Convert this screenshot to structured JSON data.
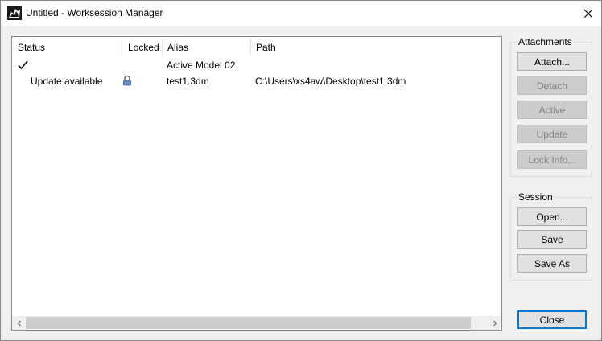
{
  "window": {
    "title": "Untitled - Worksession Manager"
  },
  "icons": {
    "app": "rhino-app-icon",
    "close": "close-icon",
    "check": "checkmark-icon",
    "lock": "lock-icon",
    "scroll_left": "chevron-left-icon",
    "scroll_right": "chevron-right-icon"
  },
  "table": {
    "columns": [
      "Status",
      "Locked",
      "Alias",
      "Path"
    ],
    "rows": [
      {
        "status": "",
        "status_icon": "checkmark-icon",
        "locked": false,
        "alias": "Active Model 02",
        "path": ""
      },
      {
        "status": "Update available",
        "status_icon": "",
        "locked": true,
        "alias": "test1.3dm",
        "path": "C:\\Users\\xs4aw\\Desktop\\test1.3dm"
      }
    ]
  },
  "attachments": {
    "label": "Attachments",
    "buttons": [
      {
        "label": "Attach...",
        "enabled": true
      },
      {
        "label": "Detach",
        "enabled": false
      },
      {
        "label": "Active",
        "enabled": false
      },
      {
        "label": "Update",
        "enabled": false
      },
      {
        "label": "Lock Info...",
        "enabled": false
      }
    ]
  },
  "session": {
    "label": "Session",
    "buttons": [
      {
        "label": "Open...",
        "enabled": true
      },
      {
        "label": "Save",
        "enabled": true
      },
      {
        "label": "Save As",
        "enabled": true
      }
    ]
  },
  "footer": {
    "close_label": "Close"
  },
  "colors": {
    "accent": "#0078d7",
    "lock": "#4a6fa5"
  }
}
